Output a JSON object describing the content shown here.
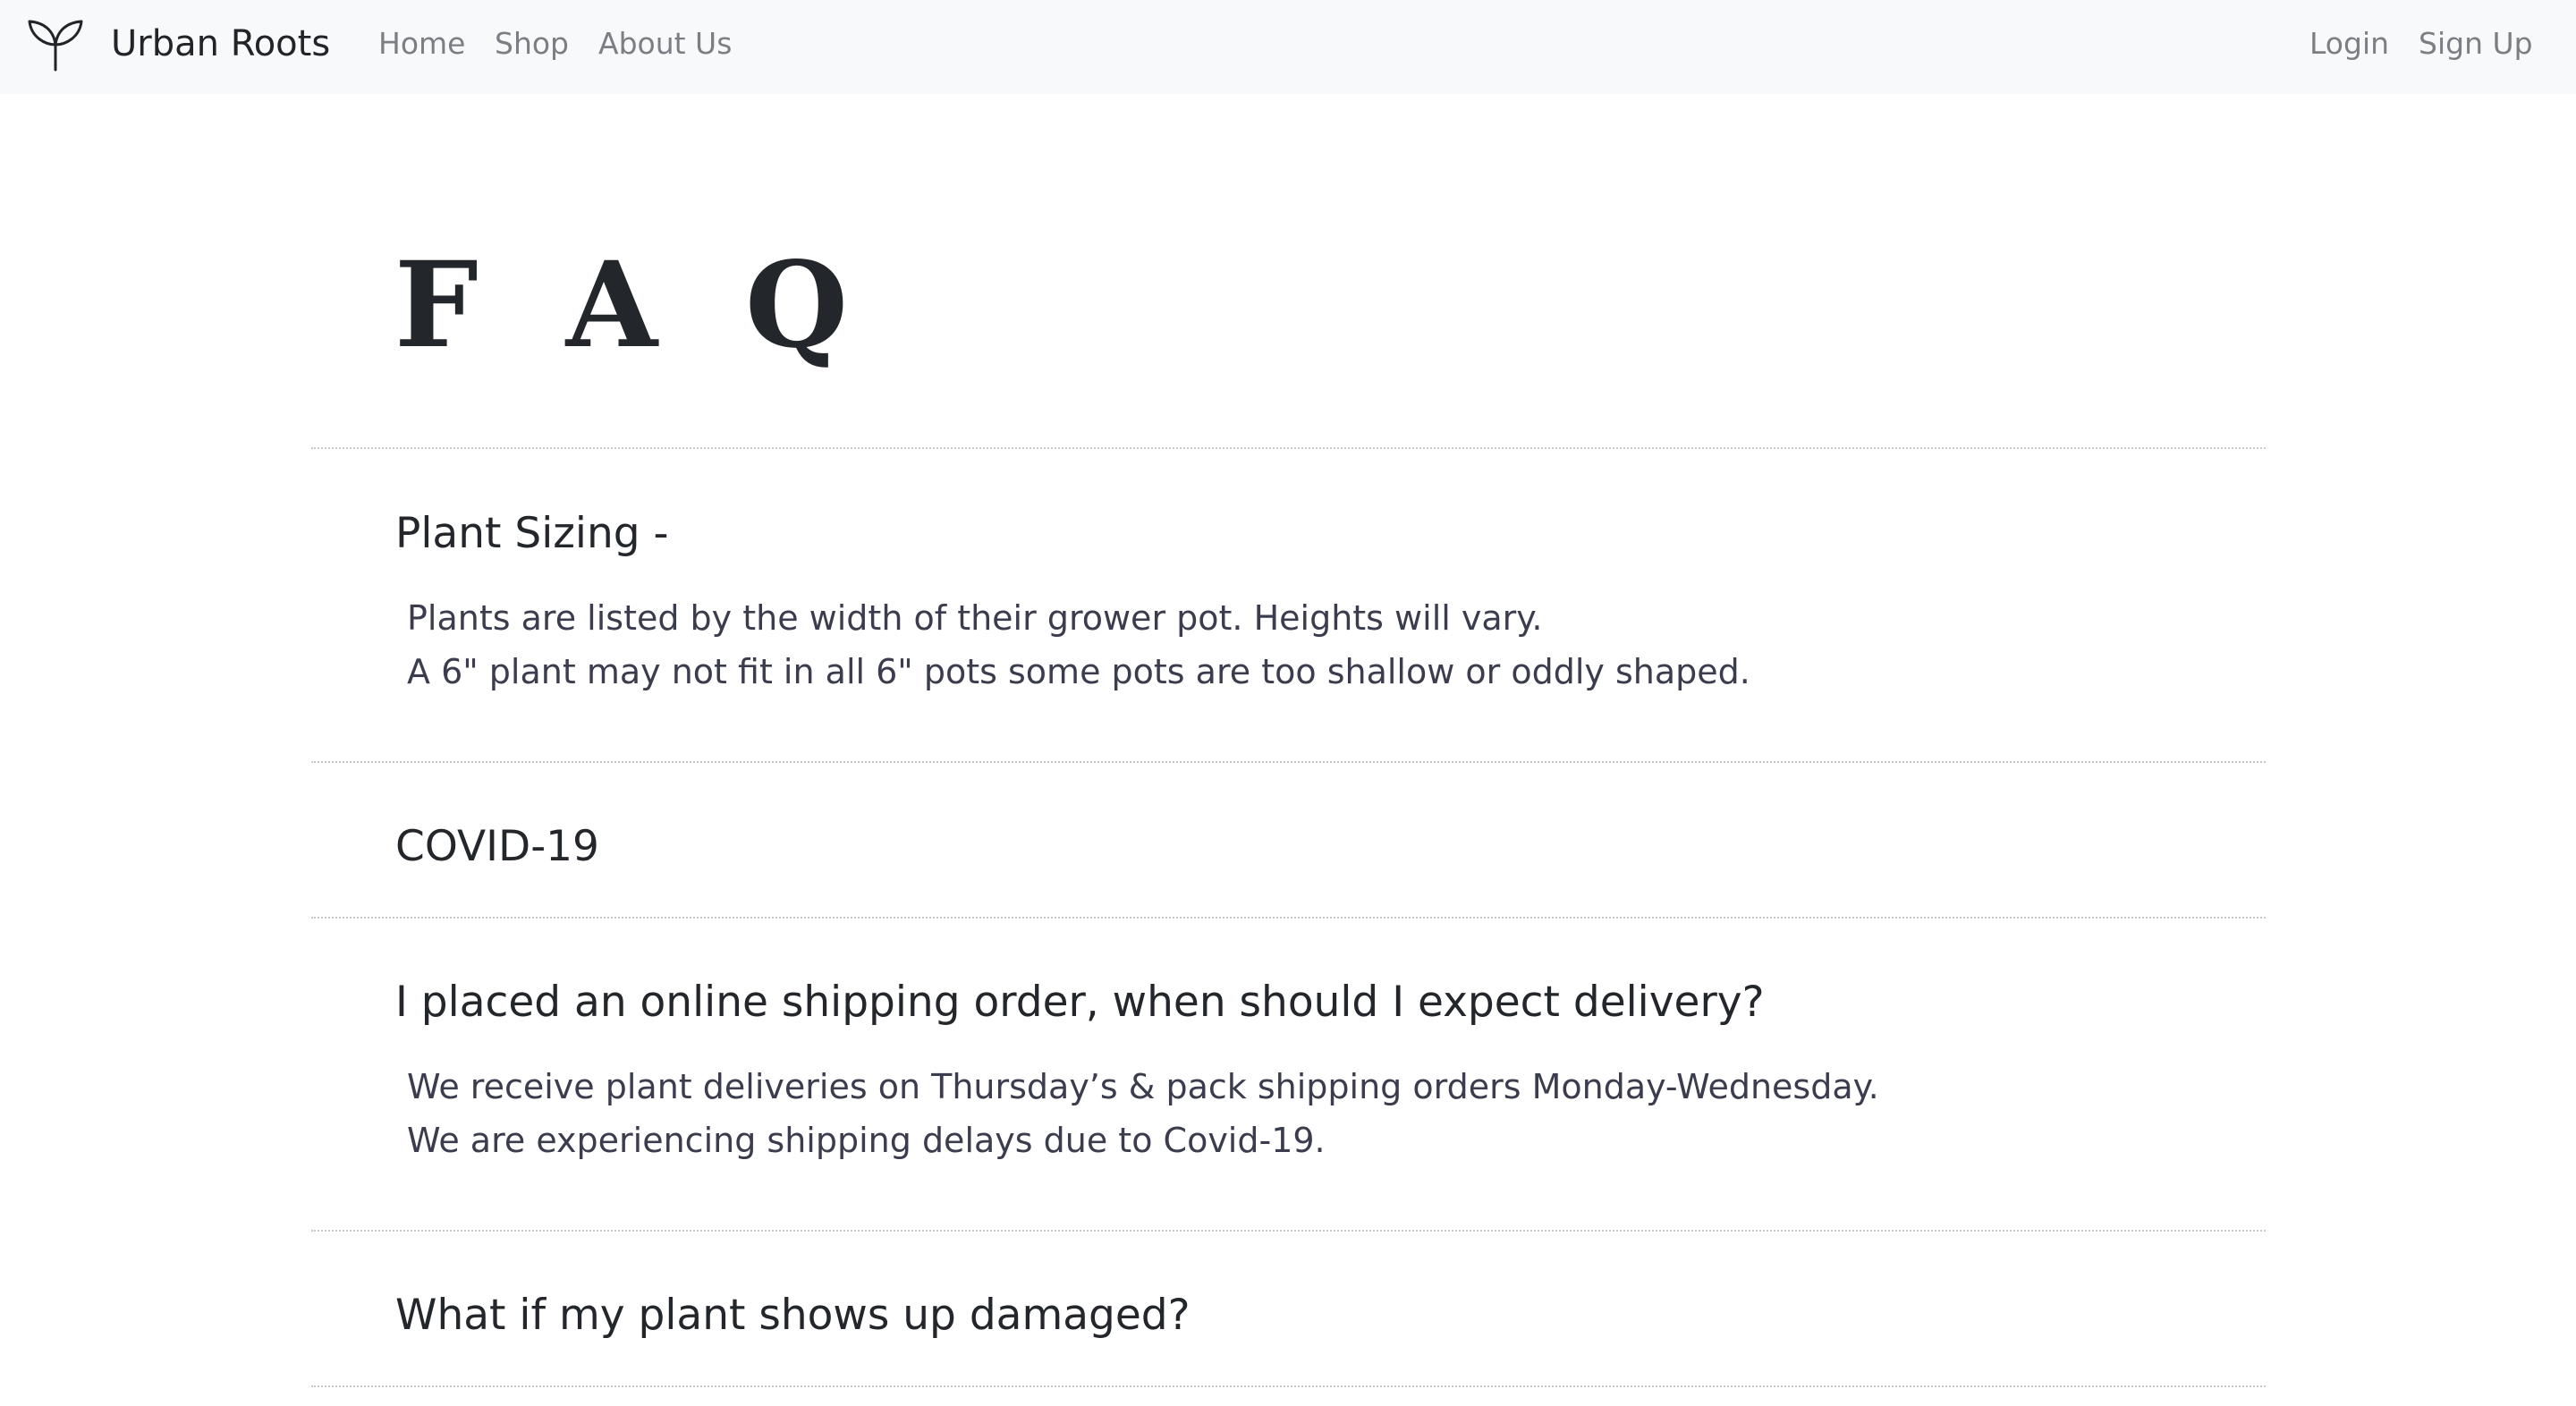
{
  "navbar": {
    "brand": "Urban Roots",
    "brand_icon": "sprout-icon",
    "links": [
      "Home",
      "Shop",
      "About Us"
    ],
    "auth": {
      "login": "Login",
      "signup": "Sign Up"
    }
  },
  "page": {
    "title": "F A Q"
  },
  "faq": [
    {
      "question": "Plant Sizing -",
      "answer": [
        "Plants are listed by the width of their grower pot. Heights will vary.",
        "A 6\" plant may not fit in all 6\" pots some pots are too shallow or oddly shaped."
      ]
    },
    {
      "question": "COVID-19",
      "answer": []
    },
    {
      "question": "I placed an online shipping order, when should I expect delivery?",
      "answer": [
        "We receive plant deliveries on Thursday’s & pack shipping orders Monday-Wednesday.",
        "We are experiencing shipping delays due to Covid-19."
      ]
    },
    {
      "question": "What if my plant shows up damaged?",
      "answer": []
    }
  ]
}
